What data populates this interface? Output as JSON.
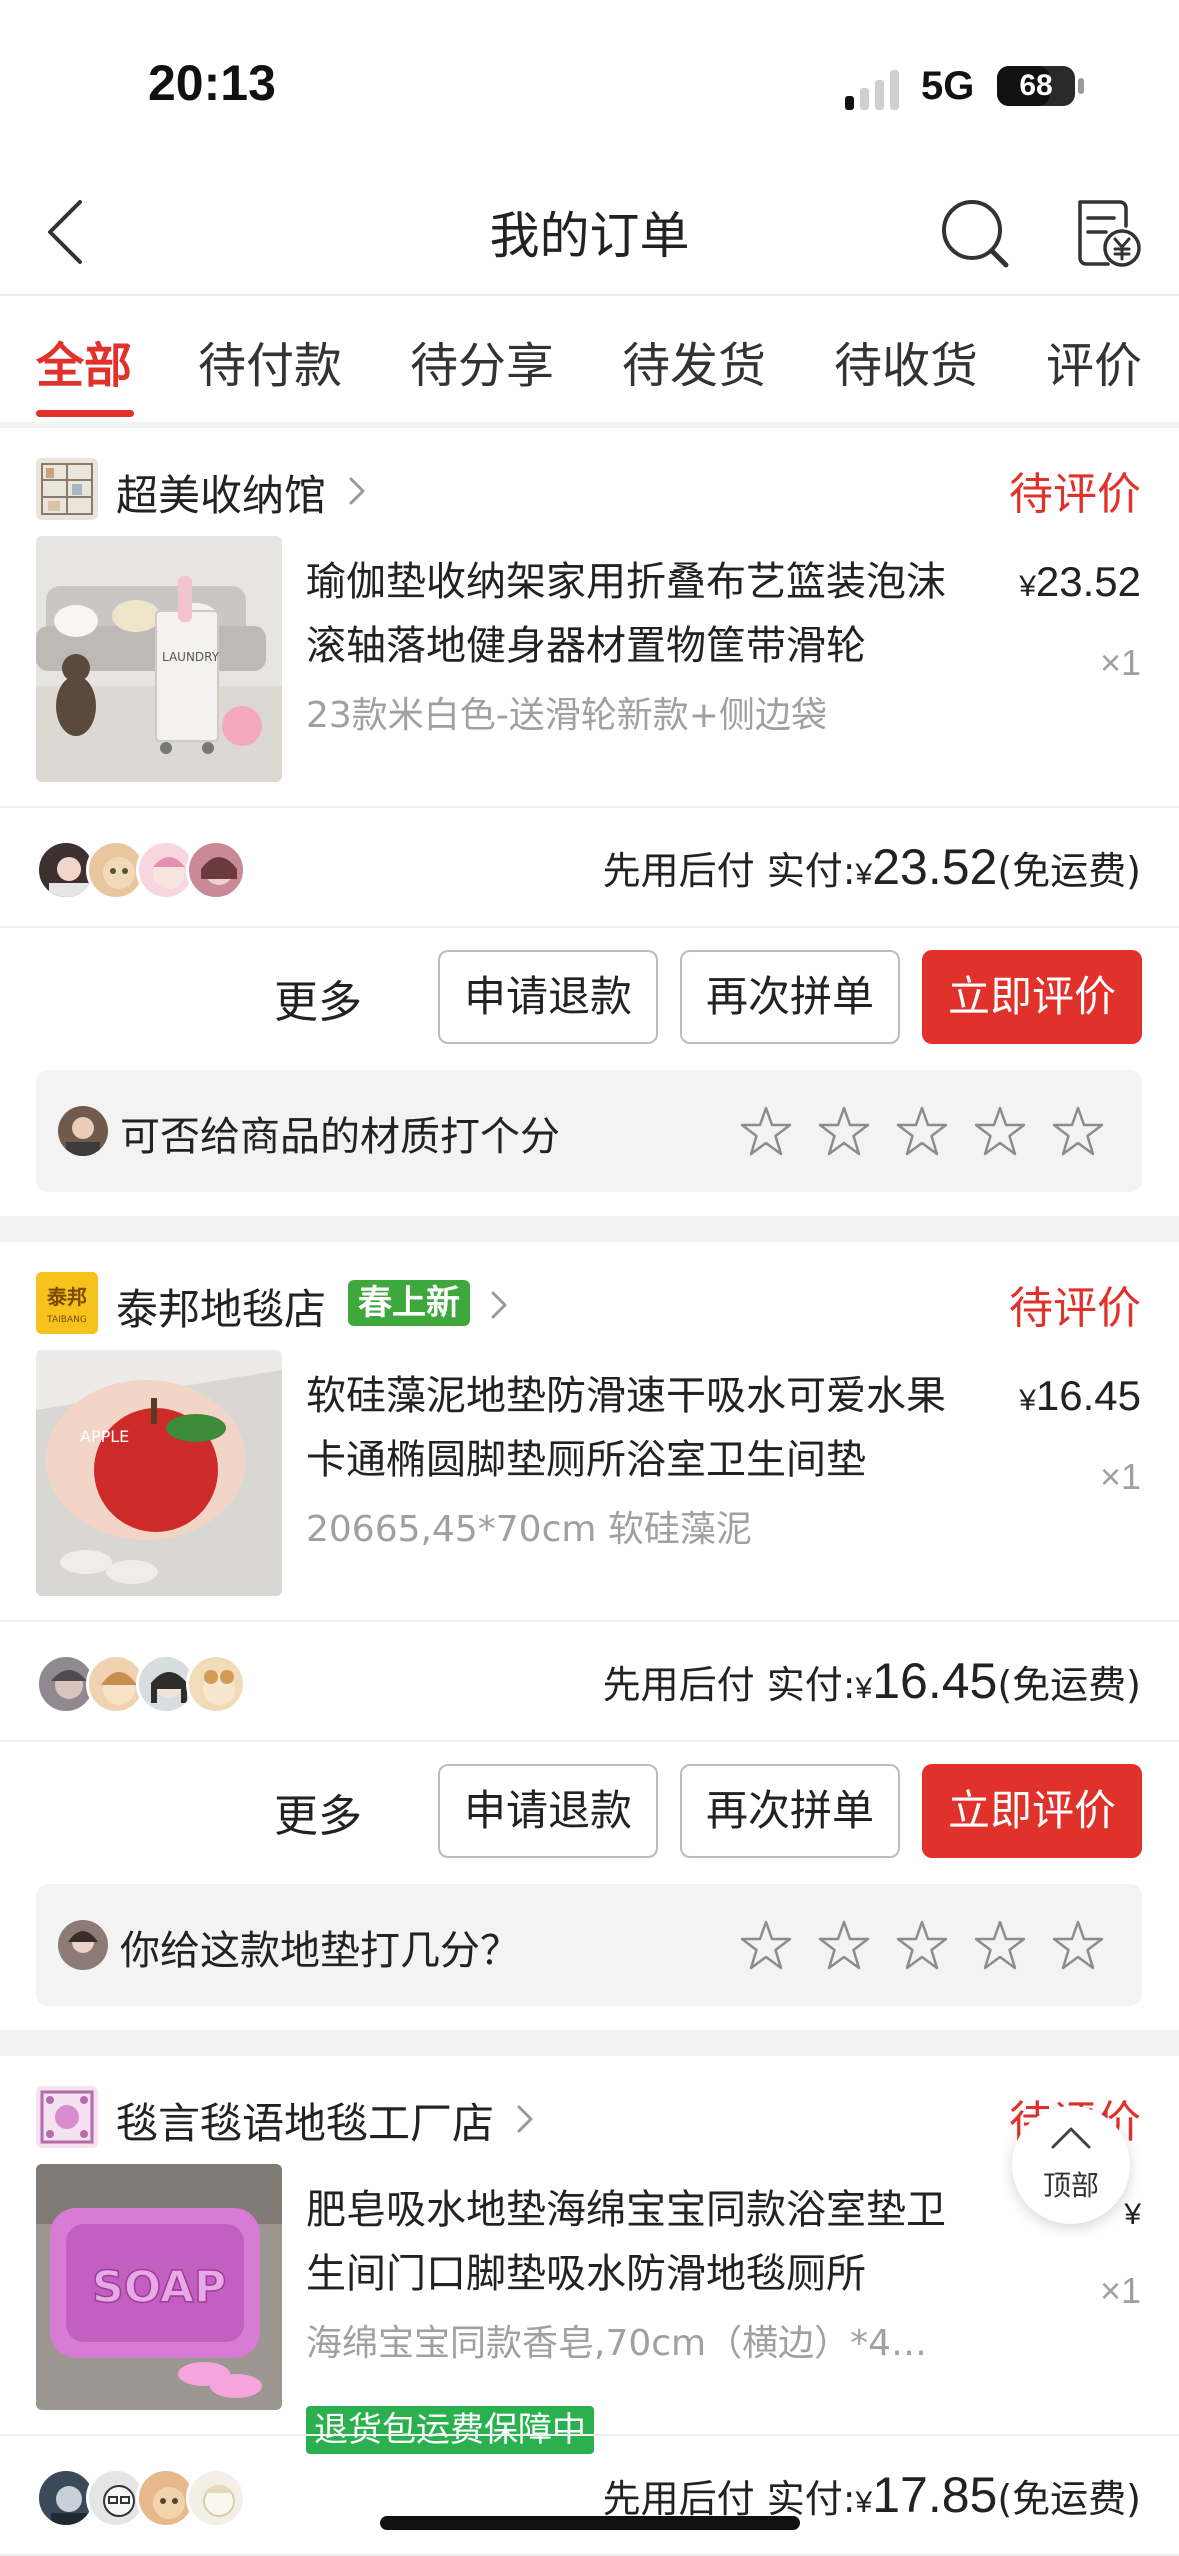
{
  "status_bar": {
    "time": "20:13",
    "network": "5G",
    "battery": "68",
    "battery_level": 0.68
  },
  "header": {
    "title": "我的订单",
    "back_icon": "back-chevron-icon",
    "search_icon": "search-icon",
    "bill_icon": "bill-icon"
  },
  "tabs": [
    {
      "label": "全部",
      "active": true
    },
    {
      "label": "待付款",
      "active": false
    },
    {
      "label": "待分享",
      "active": false
    },
    {
      "label": "待发货",
      "active": false
    },
    {
      "label": "待收货",
      "active": false
    },
    {
      "label": "评价",
      "active": false
    }
  ],
  "orders": [
    {
      "shop": {
        "name": "超美收纳馆",
        "tag": ""
      },
      "status": "待评价",
      "product": {
        "title": "瑜伽垫收纳架家用折叠布艺篮装泡沫滚轴落地健身器材置物筐带滑轮",
        "spec": "23款米白色-送滑轮新款+侧边袋",
        "currency": "¥",
        "price": "23.52",
        "qty": "×1",
        "badge": ""
      },
      "payment": {
        "label": "先用后付 实付:",
        "currency": "¥",
        "amount": "23.52",
        "note": "(免运费)"
      },
      "actions": {
        "more": "更多",
        "refund": "申请退款",
        "rebuy": "再次拼单",
        "review": "立即评价"
      },
      "rating": {
        "question": "可否给商品的材质打个分",
        "max_stars": 5
      }
    },
    {
      "shop": {
        "name": "泰邦地毯店",
        "tag": "春上新",
        "logo_text": "泰邦",
        "logo_sub": "TAIBANG"
      },
      "status": "待评价",
      "product": {
        "title": "软硅藻泥地垫防滑速干吸水可爱水果卡通椭圆脚垫厕所浴室卫生间垫",
        "spec": "20665,45*70cm 软硅藻泥",
        "currency": "¥",
        "price": "16.45",
        "qty": "×1",
        "badge": ""
      },
      "payment": {
        "label": "先用后付 实付:",
        "currency": "¥",
        "amount": "16.45",
        "note": "(免运费)"
      },
      "actions": {
        "more": "更多",
        "refund": "申请退款",
        "rebuy": "再次拼单",
        "review": "立即评价"
      },
      "rating": {
        "question": "你给这款地垫打几分？",
        "max_stars": 5
      }
    },
    {
      "shop": {
        "name": "毯言毯语地毯工厂店",
        "tag": ""
      },
      "status": "待评价",
      "product": {
        "title": "肥皂吸水地垫海绵宝宝同款浴室垫卫生间门口脚垫吸水防滑地毯厕所",
        "spec": "海绵宝宝同款香皂,70cm（横边）*45...",
        "currency": "¥",
        "price": "",
        "qty": "×1",
        "badge": "退货包运费保障中",
        "image_text": "SOAP"
      },
      "payment": {
        "label": "先用后付 实付:",
        "currency": "¥",
        "amount": "17.85",
        "note": "(免运费)"
      }
    }
  ],
  "float_button": {
    "label": "顶部"
  },
  "colors": {
    "accent": "#e0312b",
    "badge_green": "#2ab04e",
    "tag_green": "#3ea83c"
  }
}
